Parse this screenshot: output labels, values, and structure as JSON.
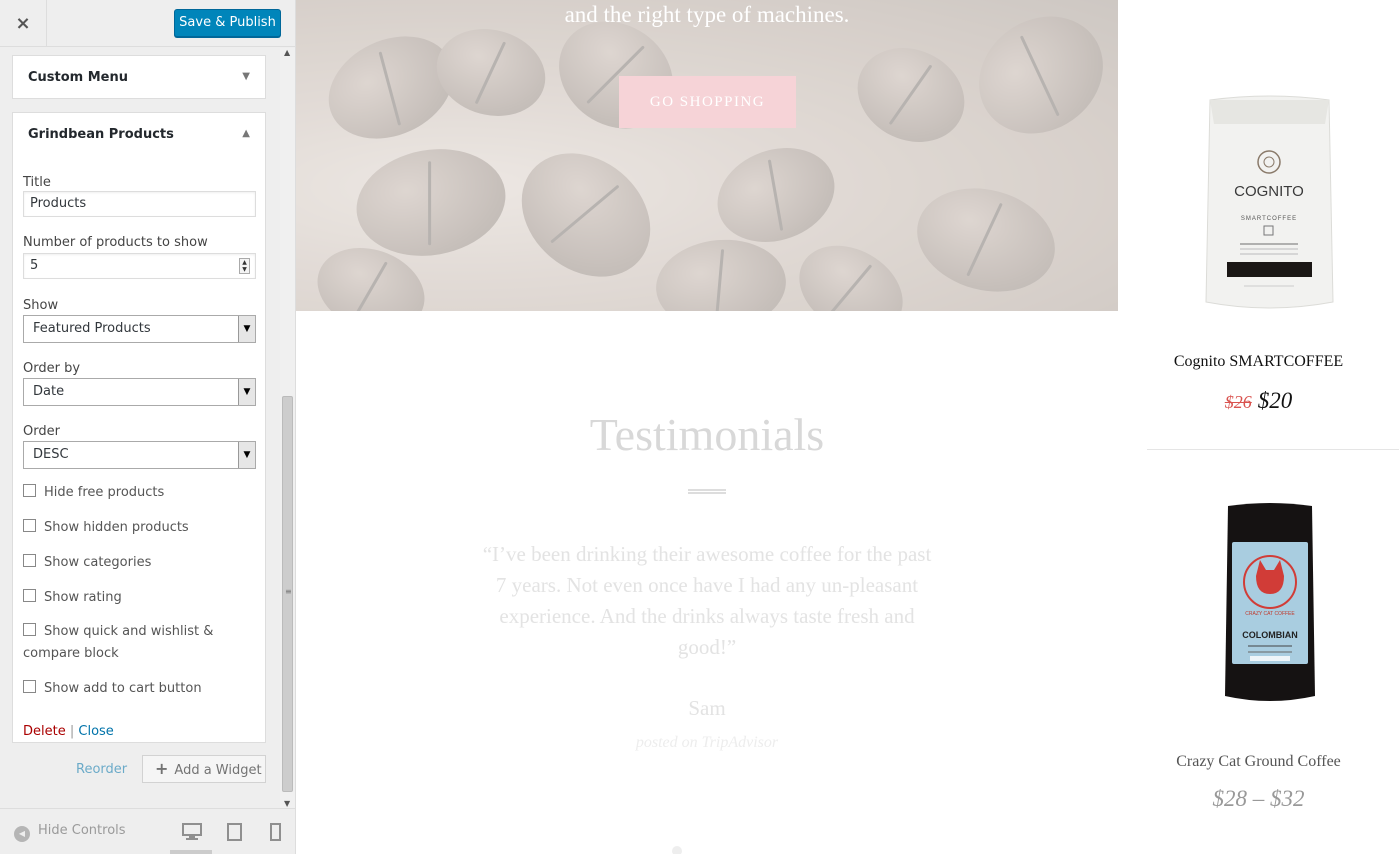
{
  "sidebar": {
    "close_icon": "×",
    "save_label": "Save & Publish",
    "sections": [
      {
        "label": "Custom Menu",
        "arrow": "▼"
      },
      {
        "label": "Grindbean Products",
        "arrow": "▲"
      }
    ],
    "widget": {
      "title_label": "Title",
      "title_value": "Products",
      "count_label": "Number of products to show",
      "count_value": "5",
      "show_label": "Show",
      "show_value": "Featured Products",
      "orderby_label": "Order by",
      "orderby_value": "Date",
      "order_label": "Order",
      "order_value": "DESC",
      "checkboxes": [
        "Hide free products",
        "Show hidden products",
        "Show categories",
        "Show rating",
        "Show quick and wishlist & compare block",
        "Show add to cart button"
      ],
      "delete_label": "Delete",
      "separator": "|",
      "close_label": "Close"
    },
    "reorder_label": "Reorder",
    "add_widget_label": "Add a Widget",
    "hide_controls_label": "Hide Controls"
  },
  "preview": {
    "hero_text": "and the right type of machines.",
    "go_shopping_label": "GO SHOPPING",
    "testimonials_title": "Testimonials",
    "quote": "“I’ve been drinking their awesome coffee for the past 7 years. Not even once have I had any un-pleasant experience. And the drinks always taste fresh and good!”",
    "author": "Sam",
    "source": "posted on TripAdvisor",
    "products": [
      {
        "name": "Cognito SMARTCOFFEE",
        "old_price": "$26",
        "price": "$20",
        "bag_brand": "COGNITO",
        "bag_sub": "SMARTCOFFEE"
      },
      {
        "name": "Crazy Cat Ground Coffee",
        "price_range": "$28 – $32",
        "bag_brand": "CRAZY CAT COFFEE",
        "bag_sub": "COLOMBIAN"
      }
    ]
  },
  "colors": {
    "primary_button": "#0085ba",
    "link": "#0073aa",
    "delete": "#a00000",
    "go_shopping_bg": "#f6d3d7",
    "old_price": "#d9534f"
  }
}
